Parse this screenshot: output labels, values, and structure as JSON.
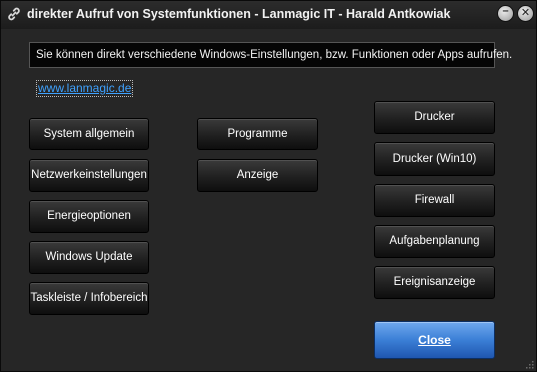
{
  "window": {
    "title": "direkter Aufruf von Systemfunktionen - Lanmagic IT - Harald Antkowiak",
    "minimize_glyph": "–",
    "close_glyph": "✕"
  },
  "info_text": "Sie können direkt verschiedene Windows-Einstellungen, bzw. Funktionen oder Apps aufrufen.",
  "link_text": "www.lanmagic.de",
  "column_left": [
    "System allgemein",
    "Netzwerkeinstellungen",
    "Energieoptionen",
    "Windows Update",
    "Taskleiste / Infobereich"
  ],
  "column_middle": [
    "Programme",
    "Anzeige"
  ],
  "column_right": [
    "Drucker",
    "Drucker (Win10)",
    "Firewall",
    "Aufgabenplanung",
    "Ereignisanzeige"
  ],
  "close_button": "Close",
  "colors": {
    "close_button": "#3b7fd6",
    "link": "#3fa2ff",
    "background": "#262626"
  }
}
